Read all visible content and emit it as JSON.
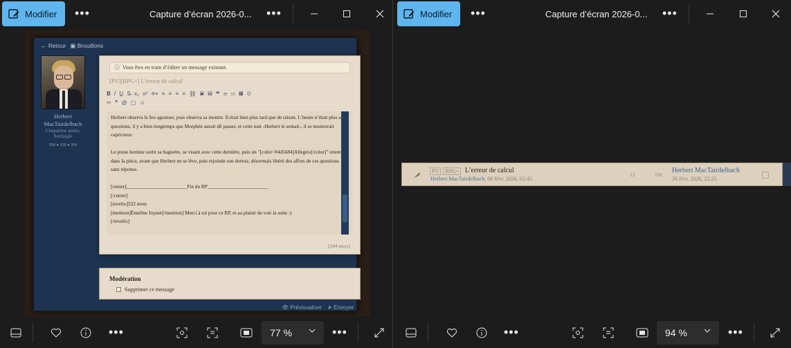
{
  "left_viewer": {
    "edit_label": "Modifier",
    "title": "Capture d’écran 2026-0...",
    "zoom": "77 %",
    "page": {
      "nav": {
        "back": "Retour",
        "drafts": "Brouillons"
      },
      "user": {
        "name": "Herbert MacTairdelbach",
        "subtitle": "Cinquième année, Serdaigle",
        "stats": "558 ● 109 ● 304"
      },
      "notice": "Vous êtes en train d’éditer un message existant.",
      "subject": "[PV][RPG+] L’erreur de calcul",
      "message": "Herbert observa le feu agoniser, puis observa sa montre. Il était bien plus tard que de raison. L’heure n’était plus aux questions, il y a bien longtemps que Morphée aurait dû passer, et cette nuit -Herbert le sentait-, il se montrerait capricieux.\n\nLe jeune homme sortit sa baguette, se visant avec cette dernière, puis un \"[color=#4d5684]Allegrio[/color]\" retentit dans la pièce, avant que Herbert ne se lève, puis rejoinde son dortoir, désormais libéré des affres de ces questions sans réponse.\n\n[center]________________________Fin du RP________________________\n[/center]\n[revelio]522 mots\n[mention]Émeline Joyner[/mention] Merci à toi pour ce RP, et au plaisir de voir la suite :)\n[/revelio]",
      "word_count": "(544 mots)",
      "moderation_title": "Modération",
      "delete_option": "Supprimer ce message",
      "preview": "Prévisualiser",
      "send": "Envoyer"
    }
  },
  "right_viewer": {
    "edit_label": "Modifier",
    "title": "Capture d’écran 2026-0...",
    "zoom": "94 %",
    "topic": {
      "tag_pv": "PV",
      "tag_rpg": "RPG+",
      "title": "L’erreur de calcul",
      "author": "Herbert MacTairdelbach",
      "date": ", 08 févr. 2026, 02:45",
      "replies": "12",
      "views": "191",
      "last_author": "Herbert MacTairdelbach",
      "last_date": "26 févr. 2026, 22:25"
    }
  }
}
